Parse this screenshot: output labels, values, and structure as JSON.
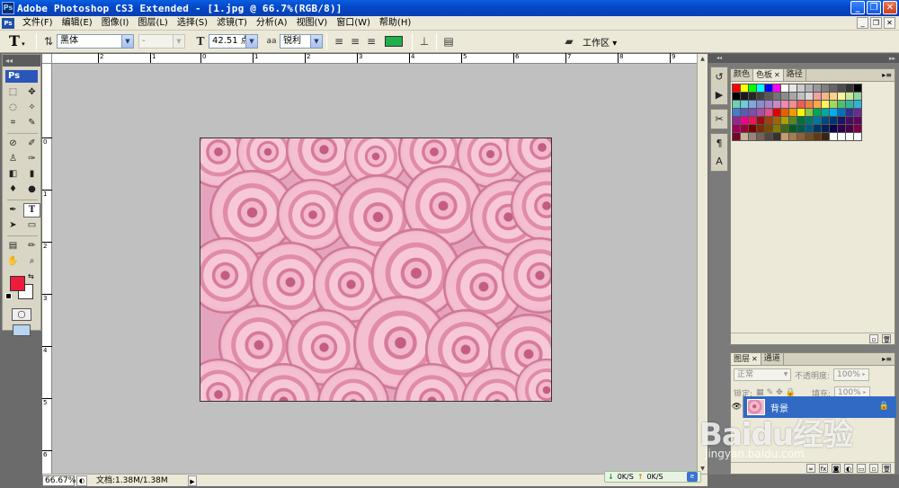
{
  "window": {
    "title": "Adobe Photoshop CS3 Extended - [1.jpg @ 66.7%(RGB/8)]",
    "app_icon": "Ps",
    "buttons": [
      "_",
      "❐",
      "✕"
    ]
  },
  "menubar": {
    "items": [
      "文件(F)",
      "编辑(E)",
      "图像(I)",
      "图层(L)",
      "选择(S)",
      "滤镜(T)",
      "分析(A)",
      "视图(V)",
      "窗口(W)",
      "帮助(H)"
    ]
  },
  "options": {
    "tool_glyph": "T",
    "font_family": "黑体",
    "font_style": "-",
    "font_size": "42.51 点",
    "aa_label": "aa",
    "antialias": "锐利",
    "text_color": "#1fb04a",
    "workspace": "工作区"
  },
  "toolbox": {
    "logo": "Ps",
    "foreground_color": "#ef1b3c",
    "background_color": "#ffffff"
  },
  "rulers": {
    "top": [
      "2",
      "1",
      "0",
      "1",
      "2",
      "3",
      "4",
      "5",
      "6",
      "7",
      "8",
      "9"
    ],
    "left": [
      "0",
      "1",
      "2",
      "3",
      "4",
      "5",
      "6"
    ]
  },
  "status": {
    "zoom": "66.67%",
    "doc": "文档:1.38M/1.38M"
  },
  "swatches_panel": {
    "tabs": [
      "颜色",
      "色板",
      "路径"
    ],
    "active_tab": "色板",
    "colors": [
      "#ff0000",
      "#ffff00",
      "#00ff00",
      "#00ffff",
      "#0000ff",
      "#ff00ff",
      "#ffffff",
      "#e6e6e6",
      "#cccccc",
      "#b3b3b3",
      "#999999",
      "#808080",
      "#666666",
      "#4d4d4d",
      "#333333",
      "#000000",
      "#000000",
      "#1a1a1a",
      "#262626",
      "#404040",
      "#595959",
      "#737373",
      "#8c8c8c",
      "#a6a6a6",
      "#bfbfbf",
      "#d9d9d9",
      "#f2a0a0",
      "#f7b68a",
      "#fbd38a",
      "#fff29a",
      "#c9e79a",
      "#8fd59d",
      "#6fcfb5",
      "#6ccbe1",
      "#7ea7dc",
      "#8c8ad0",
      "#a585c9",
      "#c589c6",
      "#ef89b1",
      "#ef8f8f",
      "#ef5a5a",
      "#f47e4a",
      "#f9a94a",
      "#fff25a",
      "#a7d75a",
      "#4fc06a",
      "#33b79a",
      "#2fb4d8",
      "#3f7fcf",
      "#5a5ab8",
      "#7a4fae",
      "#a64fa7",
      "#e64f8a",
      "#e50000",
      "#e85f00",
      "#f19a00",
      "#fff200",
      "#8cc63f",
      "#00a651",
      "#00a99d",
      "#00aeef",
      "#0072bc",
      "#2e3192",
      "#662d91",
      "#92278f",
      "#ec008c",
      "#ed145b",
      "#9e0b0f",
      "#a0410d",
      "#a36209",
      "#aba000",
      "#598527",
      "#007236",
      "#00746b",
      "#0076a3",
      "#004a80",
      "#003471",
      "#1b1464",
      "#440e62",
      "#630460",
      "#9e005d",
      "#9e0039",
      "#790000",
      "#7b2e00",
      "#7d4900",
      "#827b00",
      "#406618",
      "#005e20",
      "#005952",
      "#005b7f",
      "#003663",
      "#002157",
      "#0d004c",
      "#32004b",
      "#4b0049",
      "#7b0046",
      "#7a0026",
      "#c7b299",
      "#998675",
      "#736357",
      "#534741",
      "#37302d",
      "#c69c6d",
      "#a67c52",
      "#8c6239",
      "#754c24",
      "#603913",
      "#3c2415",
      "#ffffff",
      "#ffffff",
      "#ffffff",
      "#ffffff"
    ]
  },
  "layers_panel": {
    "tabs": [
      "图层",
      "通道"
    ],
    "blend_mode": "正常",
    "opacity_label": "不透明度:",
    "opacity": "100%",
    "lock_label": "锁定:",
    "fill_label": "填充:",
    "fill": "100%",
    "layer_name": "背景"
  },
  "network": {
    "down": "0K/S",
    "up": "0K/S"
  },
  "watermark": {
    "logo": "Baidu经验",
    "url": "jingyan.baidu.com"
  }
}
